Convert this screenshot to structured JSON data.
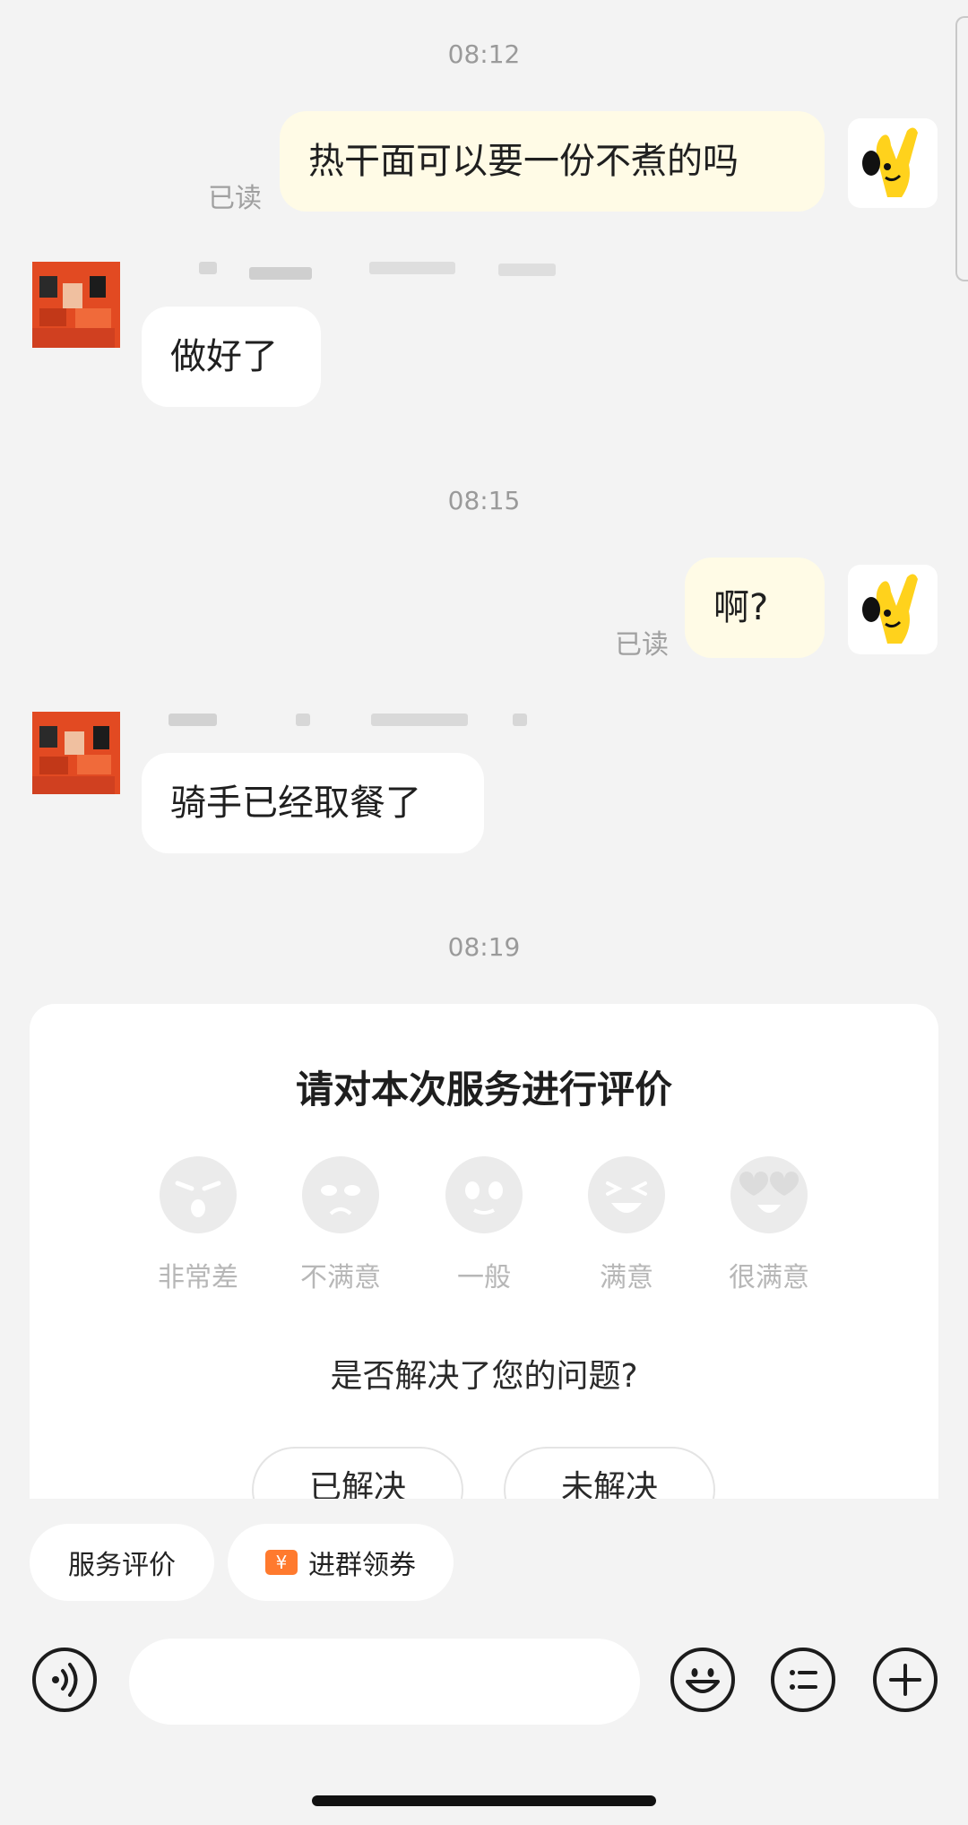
{
  "messages": {
    "t1": "08:12",
    "m1": "热干面可以要一份不煮的吗",
    "read1": "已读",
    "m2": "做好了",
    "t2": "08:15",
    "m3": "啊?",
    "read2": "已读",
    "m4": "骑手已经取餐了",
    "t3": "08:19"
  },
  "rating": {
    "title": "请对本次服务进行评价",
    "options": [
      "非常差",
      "不满意",
      "一般",
      "满意",
      "很满意"
    ],
    "question": "是否解决了您的问题?",
    "resolved": "已解决",
    "unresolved": "未解决"
  },
  "quick": {
    "service_review": "服务评价",
    "join_group": "进群领券",
    "coupon_glyph": "¥"
  },
  "icons": {
    "voice": "voice-icon",
    "emoji": "emoji-icon",
    "menu": "list-menu-icon",
    "plus": "plus-icon"
  },
  "colors": {
    "outgoing_bubble": "#fffbe6",
    "incoming_bubble": "#ffffff",
    "background": "#f3f3f3",
    "coupon": "#ff7a2e"
  }
}
